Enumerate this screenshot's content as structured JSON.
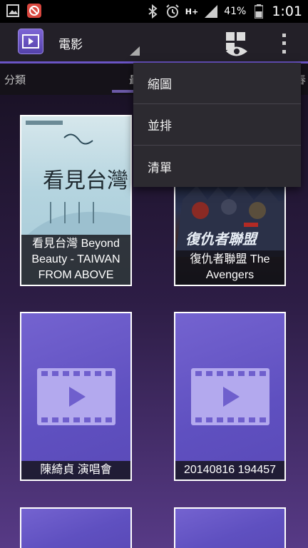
{
  "status_bar": {
    "network": "H+",
    "battery": "41%",
    "time": "1:01",
    "icons": [
      "gallery-icon",
      "notification-app-icon",
      "bluetooth-icon",
      "alarm-icon",
      "signal-icon",
      "battery-icon"
    ]
  },
  "action_bar": {
    "title": "電影",
    "icons": [
      "video-app-icon",
      "view-mode-icon",
      "overflow-menu-icon"
    ]
  },
  "tabs": {
    "category": "分類",
    "recent": "最",
    "right_fragment": "春"
  },
  "videos": [
    {
      "title": "看見台灣 Beyond Beauty - TAIWAN FROM ABOVE",
      "poster_text": "看見台灣"
    },
    {
      "title": "復仇者聯盟 The Avengers",
      "poster_text": "復仇者聯盟"
    },
    {
      "title": "陳綺貞 演唱會"
    },
    {
      "title": "20140816 194457"
    }
  ],
  "menu": {
    "items": [
      "縮圖",
      "並排",
      "清單"
    ]
  },
  "colors": {
    "accent": "#6a54c4",
    "card_purple": "#6655c8",
    "menu_bg": "#2c2a30"
  }
}
